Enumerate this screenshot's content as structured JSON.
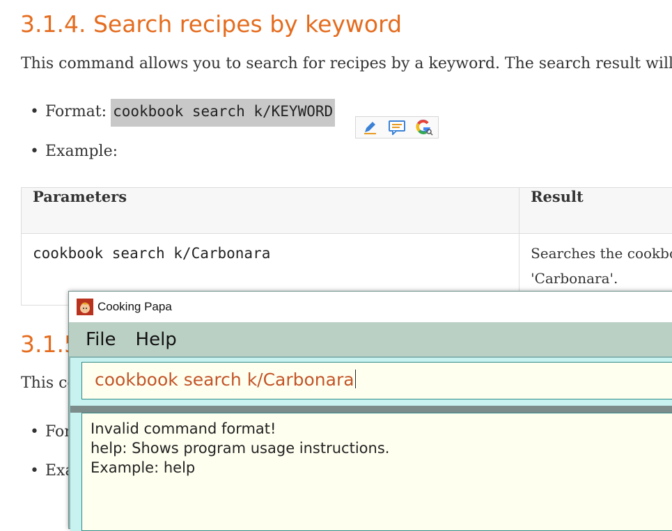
{
  "doc": {
    "section1": {
      "heading": "3.1.4. Search recipes by keyword",
      "intro": "This command allows you to search for recipes by a keyword. The search result will be returne",
      "format_label": "Format:",
      "format_code": "cookbook search k/KEYWORD",
      "example_label": "Example:"
    },
    "table": {
      "headers": [
        "Parameters",
        "Result"
      ],
      "rows": [
        {
          "param": "cookbook search k/Carbonara",
          "result_line1": "Searches the cookbo",
          "result_line2": "'Carbonara'."
        }
      ]
    },
    "section2": {
      "heading_partial": "3.1.5",
      "intro_partial": "This co",
      "format_partial": "For",
      "example_partial": "Exa"
    },
    "context_toolbar": {
      "icons": [
        "pencil-icon",
        "comment-icon",
        "google-search-icon"
      ]
    }
  },
  "app": {
    "title": "Cooking Papa",
    "menu": [
      "File",
      "Help"
    ],
    "command_input": "cookbook search k/Carbonara",
    "result": [
      "Invalid command format!",
      "help: Shows program usage instructions.",
      "Example: help"
    ]
  },
  "colors": {
    "heading": "#e46c1e",
    "menubar": "#bbd0c5",
    "pane": "#c7f2f0",
    "input_text": "#c25528",
    "box_bg": "#fffff0"
  }
}
